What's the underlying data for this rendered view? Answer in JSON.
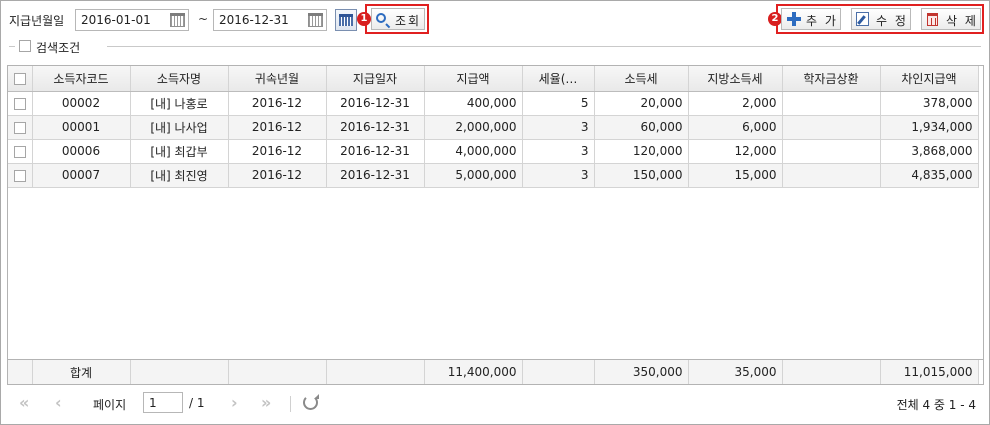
{
  "filter": {
    "label": "지급년월일",
    "from_date": "2016-01-01",
    "tilde": "~",
    "to_date": "2016-12-31"
  },
  "toolbar": {
    "search_label": "조회",
    "add_label": "추 가",
    "edit_label": "수 정",
    "delete_label": "삭 제",
    "badge_1": "1",
    "badge_2": "2",
    "highlight_color": "#e02020",
    "accent_color": "#2d6cc0"
  },
  "search_condition": {
    "label": "검색조건"
  },
  "grid": {
    "columns": [
      "소득자코드",
      "소득자명",
      "귀속년월",
      "지급일자",
      "지급액",
      "세율(…",
      "소득세",
      "지방소득세",
      "학자금상환",
      "차인지급액"
    ],
    "rows": [
      [
        "00002",
        "[내] 나홍로",
        "2016-12",
        "2016-12-31",
        "400,000",
        "5",
        "20,000",
        "2,000",
        "",
        "378,000"
      ],
      [
        "00001",
        "[내] 나사업",
        "2016-12",
        "2016-12-31",
        "2,000,000",
        "3",
        "60,000",
        "6,000",
        "",
        "1,934,000"
      ],
      [
        "00006",
        "[내] 최갑부",
        "2016-12",
        "2016-12-31",
        "4,000,000",
        "3",
        "120,000",
        "12,000",
        "",
        "3,868,000"
      ],
      [
        "00007",
        "[내] 최진영",
        "2016-12",
        "2016-12-31",
        "5,000,000",
        "3",
        "150,000",
        "15,000",
        "",
        "4,835,000"
      ]
    ],
    "summary": [
      "합계",
      "",
      "",
      "",
      "11,400,000",
      "",
      "350,000",
      "35,000",
      "",
      "11,015,000"
    ]
  },
  "pager": {
    "first": "«",
    "prev": "‹",
    "label": "페이지",
    "page": "1",
    "total": "/ 1",
    "next": "›",
    "last": "»",
    "info": "전체 4 중 1 - 4"
  }
}
